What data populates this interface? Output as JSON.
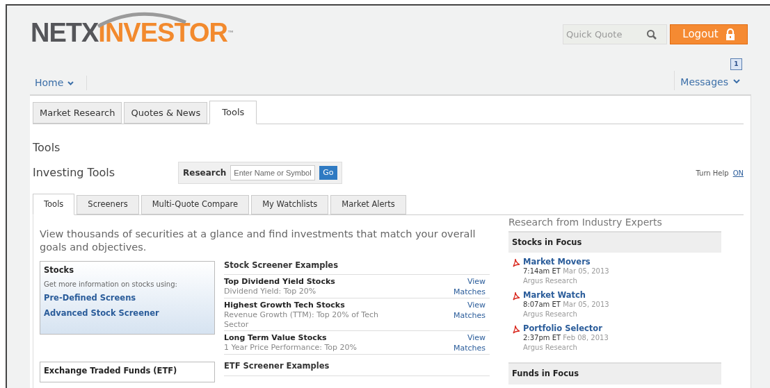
{
  "logo": {
    "dark": "NETX",
    "accent": "INVESTOR",
    "mark": "™"
  },
  "quick_quote": {
    "placeholder": "Quick Quote"
  },
  "logout": {
    "label": "Logout"
  },
  "nav": {
    "home": "Home",
    "messages": "Messages",
    "message_count": "1"
  },
  "main_tabs": [
    {
      "label": "Market Research",
      "selected": false
    },
    {
      "label": "Quotes & News",
      "selected": false
    },
    {
      "label": "Tools",
      "selected": true
    }
  ],
  "page_title": "Tools",
  "section_title": "Investing Tools",
  "research": {
    "label": "Research",
    "placeholder": "Enter Name or Symbol",
    "button": "Go"
  },
  "help": {
    "label": "Turn Help",
    "link": "ON"
  },
  "tool_tabs": [
    {
      "label": "Tools",
      "selected": true
    },
    {
      "label": "Screeners",
      "selected": false
    },
    {
      "label": "Multi-Quote Compare",
      "selected": false
    },
    {
      "label": "My Watchlists",
      "selected": false
    },
    {
      "label": "Market Alerts",
      "selected": false
    }
  ],
  "intro": "View thousands of securities at a glance and find investments that match your overall goals and objectives.",
  "categories": [
    {
      "title": "Stocks",
      "subtitle": "Get more information on stocks using:",
      "links": [
        "Pre-Defined Screens",
        "Advanced Stock Screener"
      ],
      "heading": "Stock Screener Examples",
      "examples": [
        {
          "name": "Top Dividend Yield Stocks",
          "criteria": "Dividend Yield: Top 20%",
          "link": "View Matches"
        },
        {
          "name": "Highest Growth Tech Stocks",
          "criteria": "Revenue Growth (TTM): Top 20% of Tech Sector",
          "link": "View Matches"
        },
        {
          "name": "Long Term Value Stocks",
          "criteria": "1 Year Price Performance: Top 20%",
          "link": "View Matches"
        }
      ]
    },
    {
      "title": "Exchange Traded Funds (ETF)",
      "heading": "ETF Screener Examples"
    }
  ],
  "experts": {
    "title": "Research from Industry Experts",
    "sections": [
      {
        "heading": "Stocks in Focus",
        "items": [
          {
            "title": "Market Movers",
            "time": "7:14am ET",
            "date": "Mar 05, 2013",
            "source": "Argus Research"
          },
          {
            "title": "Market Watch",
            "time": "8:07am ET",
            "date": "Mar 05, 2013",
            "source": "Argus Research"
          },
          {
            "title": "Portfolio Selector",
            "time": "2:37pm ET",
            "date": "Feb 08, 2013",
            "source": "Argus Research"
          }
        ]
      },
      {
        "heading": "Funds in Focus"
      }
    ]
  }
}
